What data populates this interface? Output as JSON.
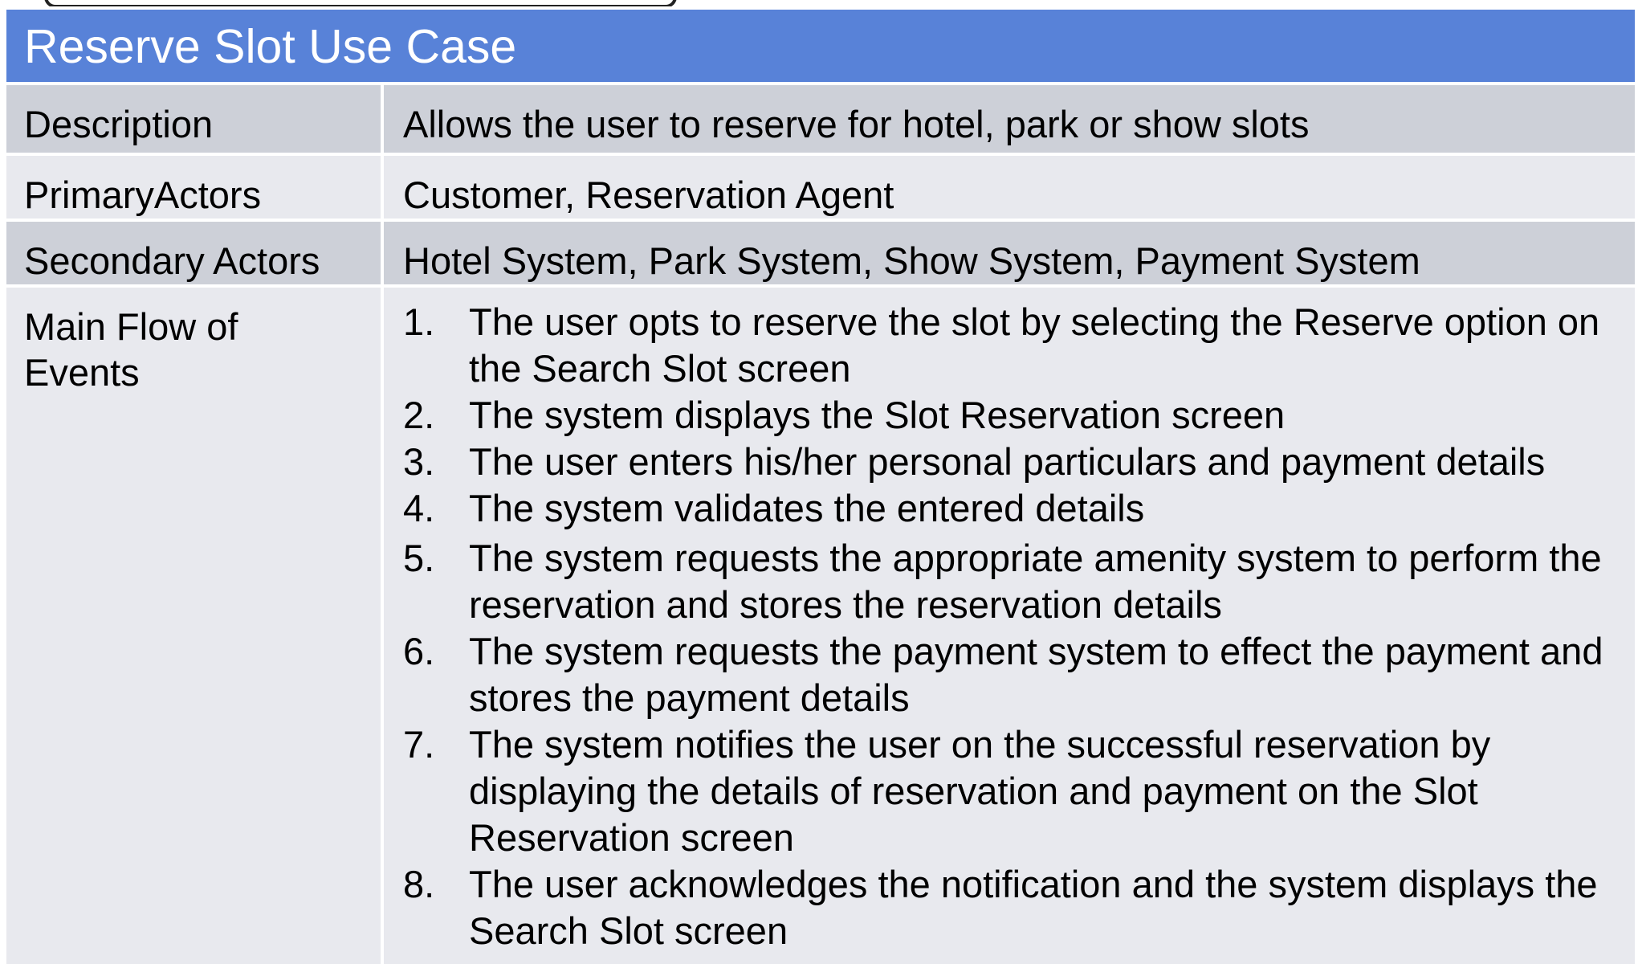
{
  "title": "Reserve Slot Use Case",
  "rows": [
    {
      "label": "Description",
      "value": "Allows the user to reserve for hotel, park or show slots"
    },
    {
      "label": "PrimaryActors",
      "value": "Customer, Reservation Agent"
    },
    {
      "label": "Secondary Actors",
      "value": "Hotel System, Park System, Show System, Payment System"
    }
  ],
  "main_flow": {
    "label_line1": "Main Flow of",
    "label_line2": "Events",
    "steps": [
      {
        "num": "1.",
        "text": "The user opts to reserve the slot by selecting the Reserve option on the Search Slot screen"
      },
      {
        "num": "2.",
        "text": "The system displays the Slot Reservation screen"
      },
      {
        "num": "3.",
        "text": "The user enters his/her personal particulars and payment details"
      },
      {
        "num": "4.",
        "text": "The system validates the entered details"
      },
      {
        "num": "5.",
        "text": "The system requests the appropriate amenity system to perform the reservation and stores the reservation details"
      },
      {
        "num": "6.",
        "text": "The system requests the payment system to effect the payment and stores the payment details"
      },
      {
        "num": "7.",
        "text": "The system notifies the user on the successful reservation by displaying the details of reservation and payment on the Slot Reservation screen"
      },
      {
        "num": "8.",
        "text": "The user acknowledges the notification and the system displays the Search Slot screen"
      }
    ]
  }
}
